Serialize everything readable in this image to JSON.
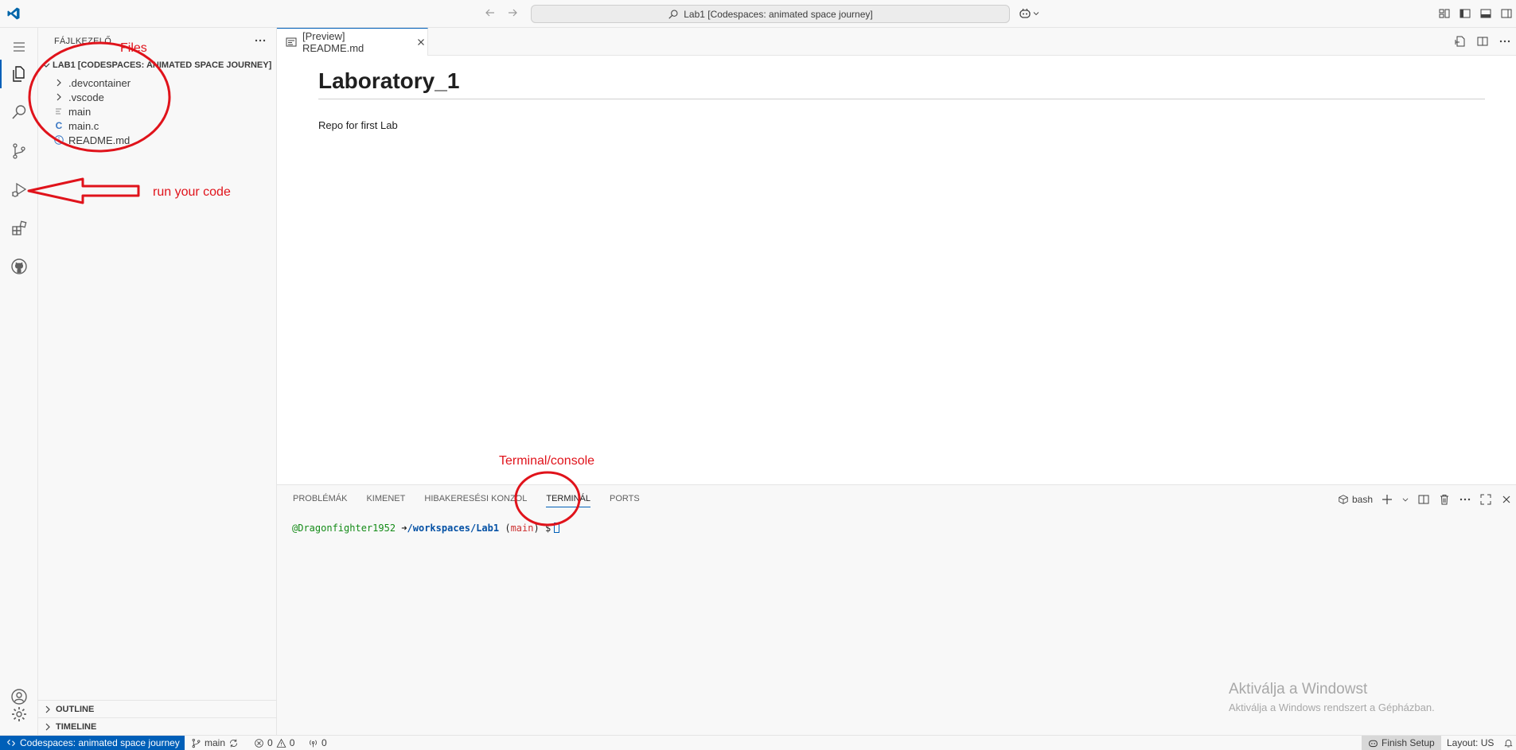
{
  "titlebar": {
    "command_center": "Lab1 [Codespaces: animated space journey]"
  },
  "activitybar": {
    "items": [
      "explorer-icon",
      "search-icon",
      "source-control-icon",
      "run-debug-icon",
      "extensions-icon",
      "github-icon"
    ],
    "bottom": [
      "account-icon",
      "settings-gear-icon"
    ]
  },
  "sidebar": {
    "title": "FÁJLKEZELŐ",
    "workspace": "LAB1 [CODESPACES: ANIMATED SPACE JOURNEY]",
    "items": [
      {
        "label": ".devcontainer",
        "type": "folder"
      },
      {
        "label": ".vscode",
        "type": "folder"
      },
      {
        "label": "main",
        "type": "file"
      },
      {
        "label": "main.c",
        "type": "c-file"
      },
      {
        "label": "README.md",
        "type": "info-file"
      }
    ],
    "outline": "OUTLINE",
    "timeline": "TIMELINE"
  },
  "editor": {
    "tab_label": "[Preview] README.md",
    "heading": "Laboratory_1",
    "paragraph": "Repo for first Lab"
  },
  "panel": {
    "tabs": [
      "PROBLÉMÁK",
      "KIMENET",
      "HIBAKERESÉSI KONZOL",
      "TERMINÁL",
      "PORTS"
    ],
    "active_tab": "TERMINÁL",
    "shell": "bash",
    "prompt": {
      "user": "@Dragonfighter1952",
      "arrow": "➜",
      "path": "/workspaces/Lab1",
      "branch": "main",
      "dollar": "$"
    },
    "watermark_title": "Aktiválja a Windowst",
    "watermark_sub": "Aktiválja a Windows rendszert a Gépházban."
  },
  "statusbar": {
    "remote": "Codespaces: animated space journey",
    "branch": "main",
    "errors": "0",
    "warnings": "0",
    "ports": "0",
    "finish_setup": "Finish Setup",
    "layout": "Layout: US"
  },
  "annotations": {
    "files": "Files",
    "run": "run your code",
    "terminal": "Terminal/console",
    "color": "#e0131b"
  },
  "colors": {
    "accent": "#005fb8",
    "background": "#f8f8f8",
    "editor": "#ffffff"
  }
}
